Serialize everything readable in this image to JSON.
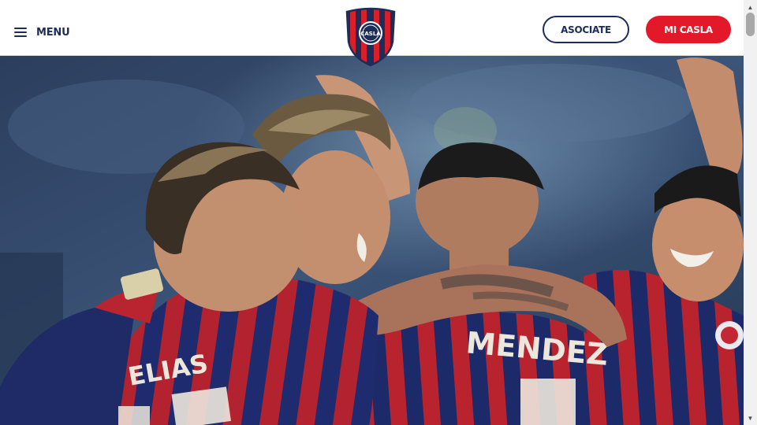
{
  "header": {
    "menu_label": "MENU",
    "asociate_label": "ASOCIATE",
    "micasla_label": "MI CASLA",
    "crest_text": "CASLA"
  },
  "hero": {
    "jersey_names": [
      "ELIAS",
      "MENDEZ"
    ]
  },
  "colors": {
    "navy": "#1c2d5a",
    "red": "#e3192a",
    "white": "#ffffff"
  },
  "icons": {
    "menu": "hamburger-icon",
    "scroll_up": "arrow-up-icon",
    "scroll_down": "arrow-down-icon"
  }
}
